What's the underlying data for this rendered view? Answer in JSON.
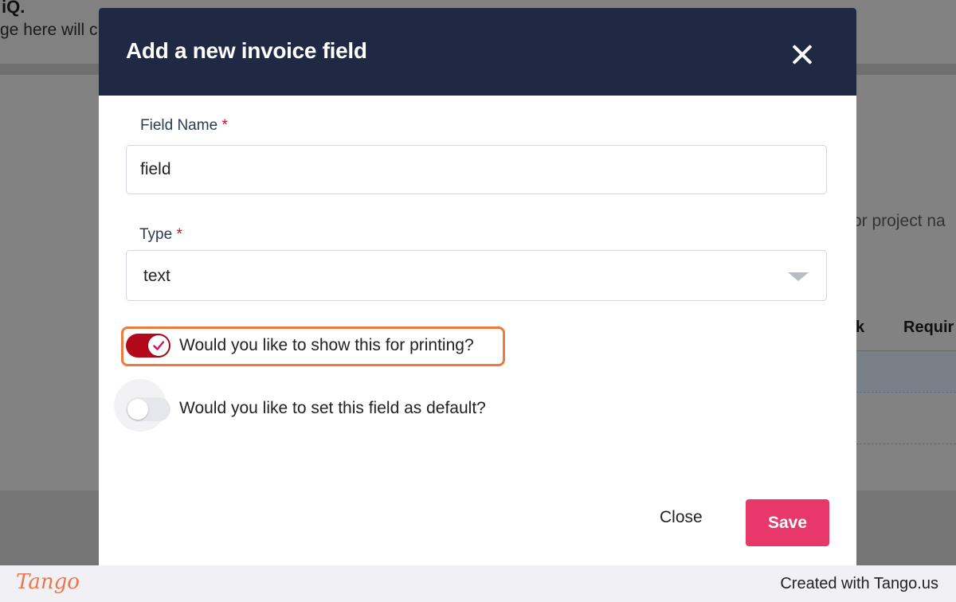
{
  "background": {
    "heading_fragment": "iQ.",
    "subtext_fragment": "ge here will c",
    "right_text_fragment": "or project na",
    "column_fragment_1": "k",
    "column_fragment_2": "Requir"
  },
  "modal": {
    "title": "Add a new invoice field",
    "close_icon": "close-icon",
    "field_name": {
      "label": "Field Name",
      "required_mark": "*",
      "value": "field"
    },
    "type": {
      "label": "Type",
      "required_mark": "*",
      "selected": "text"
    },
    "toggles": [
      {
        "label": "Would you like to show this for printing?",
        "checked": true
      },
      {
        "label": "Would you like to set this field as default?",
        "checked": false
      }
    ],
    "buttons": {
      "close_label": "Close",
      "save_label": "Save"
    }
  },
  "footer": {
    "logo_text": "Tango",
    "credit": "Created with Tango.us"
  },
  "colors": {
    "header_bg": "#1f2944",
    "toggle_on": "#b3081a",
    "save_button": "#e8386a",
    "highlight": "#f07a3d"
  }
}
